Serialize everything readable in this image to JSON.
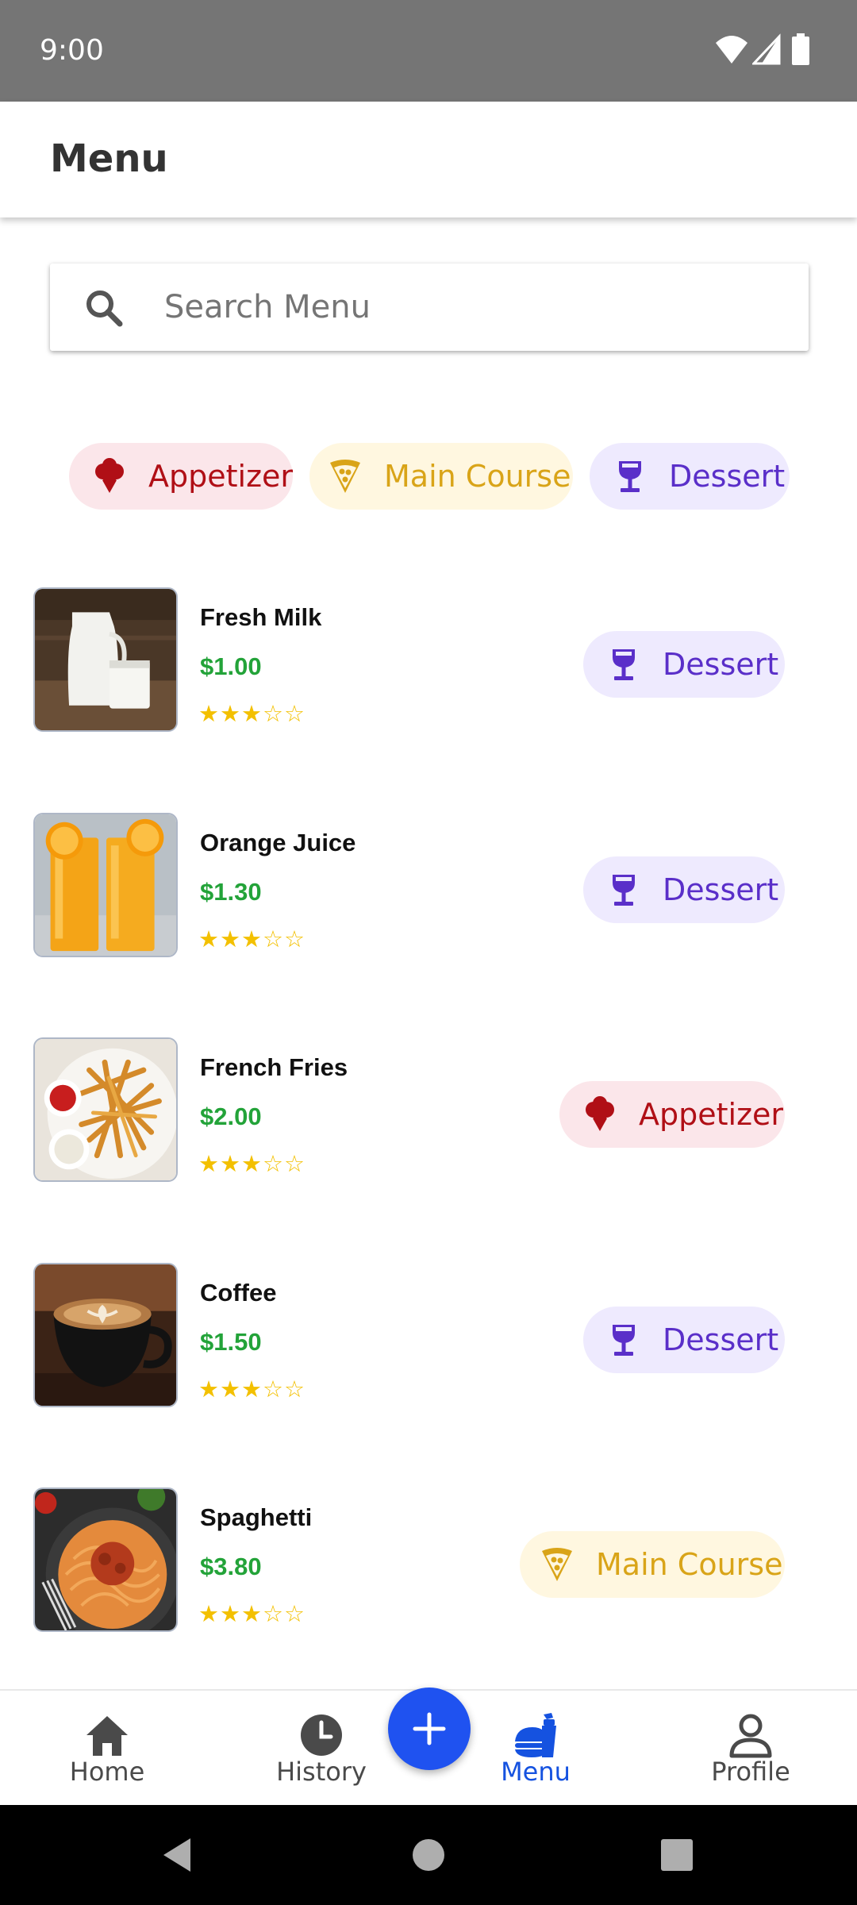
{
  "status_bar": {
    "time": "9:00"
  },
  "app_bar": {
    "title": "Menu"
  },
  "search": {
    "placeholder": "Search Menu",
    "value": ""
  },
  "filters": [
    {
      "label": "Appetizer",
      "icon": "ice-cream-icon",
      "color": "#b00f16"
    },
    {
      "label": "Main Course",
      "icon": "pizza-slice-icon",
      "color": "#d9a418"
    },
    {
      "label": "Dessert",
      "icon": "wine-glass-icon",
      "color": "#5a2fc9"
    }
  ],
  "menu_items": [
    {
      "name": "Fresh Milk",
      "price": "$1.00",
      "rating": "★★★☆☆",
      "category": "Dessert",
      "image": "milk-pitcher-photo"
    },
    {
      "name": "Orange Juice",
      "price": "$1.30",
      "rating": "★★★☆☆",
      "category": "Dessert",
      "image": "orange-juice-photo"
    },
    {
      "name": "French Fries",
      "price": "$2.00",
      "rating": "★★★☆☆",
      "category": "Appetizer",
      "image": "french-fries-photo"
    },
    {
      "name": "Coffee",
      "price": "$1.50",
      "rating": "★★★☆☆",
      "category": "Dessert",
      "image": "coffee-cup-photo"
    },
    {
      "name": "Spaghetti",
      "price": "$3.80",
      "rating": "★★★☆☆",
      "category": "Main Course",
      "image": "spaghetti-photo"
    }
  ],
  "bottom_nav": {
    "items": [
      {
        "label": "Home",
        "icon": "home-icon"
      },
      {
        "label": "History",
        "icon": "clock-icon"
      },
      {
        "label": "Menu",
        "icon": "food-icon",
        "active": true
      },
      {
        "label": "Profile",
        "icon": "person-icon"
      }
    ],
    "fab_icon": "plus-icon"
  },
  "colors": {
    "price": "#23a339",
    "rating": "#f3c000",
    "accent": "#1f52f0",
    "appetizer_bg": "#fbe6ea",
    "main_course_bg": "#fff7e0",
    "dessert_bg": "#eeeafe"
  }
}
